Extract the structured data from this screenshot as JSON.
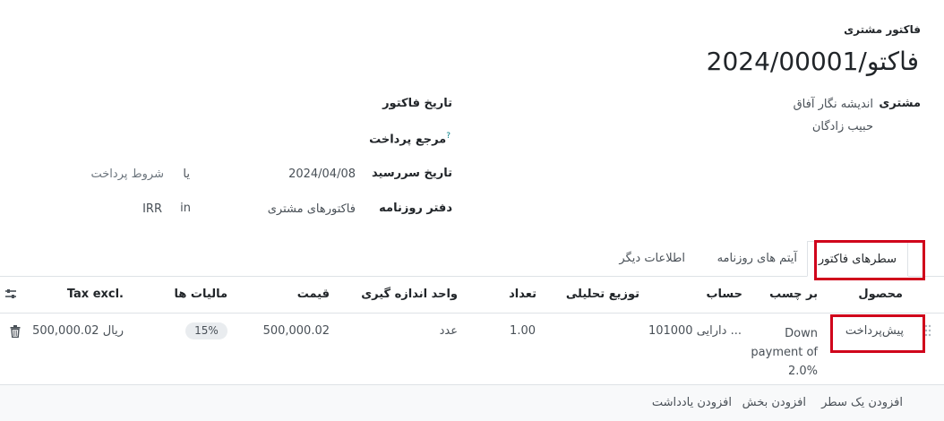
{
  "header": {
    "doc_type": "فاکتور مشتری",
    "title": "فاکتو/2024/00001"
  },
  "customer": {
    "label": "مشتری",
    "company": "اندیشه نگار آفاق",
    "contact": "حبیب زادگان"
  },
  "fields": {
    "invoice_date_label": "تاریخ فاکتور",
    "payment_ref_label": "مرجع پرداخت",
    "payment_ref_help": "?",
    "due_date_label": "تاریخ سررسید",
    "due_date_value": "2024/04/08",
    "due_or": "یا",
    "payment_terms_placeholder": "شروط پرداخت",
    "journal_label": "دفتر روزنامه",
    "journal_value": "فاکتورهای مشتری",
    "journal_in": "in",
    "currency": "IRR"
  },
  "tabs": [
    {
      "label": "سطرهای فاکتور",
      "active": true
    },
    {
      "label": "آیتم های روزنامه",
      "active": false
    },
    {
      "label": "اطلاعات دیگر",
      "active": false
    }
  ],
  "table": {
    "headers": {
      "product": "محصول",
      "label": "بر چسب",
      "account": "حساب",
      "analytic": "توزیع تحلیلی",
      "quantity": "تعداد",
      "uom": "واحد اندازه گیری",
      "price": "قیمت",
      "taxes": "مالیات ها",
      "subtotal": "Tax excl."
    },
    "rows": [
      {
        "product": "پیش‌پرداخت",
        "label_lines": [
          "Down",
          "payment of",
          "2.0%"
        ],
        "account": "101000 دارایی ...",
        "quantity": "1.00",
        "uom": "عدد",
        "price": "500,000.02",
        "tax": "15%",
        "subtotal": "500,000.02 ریال"
      }
    ],
    "footer_links": {
      "add_line": "افزودن یک سطر",
      "add_section": "افزودن بخش",
      "add_note": "افزودن یادداشت"
    }
  },
  "icons": {
    "settings": "sliders-icon",
    "delete": "trash-icon",
    "drag": "drag-handle-icon"
  },
  "colors": {
    "highlight": "#d0021b",
    "link_teal": "#017e84"
  }
}
